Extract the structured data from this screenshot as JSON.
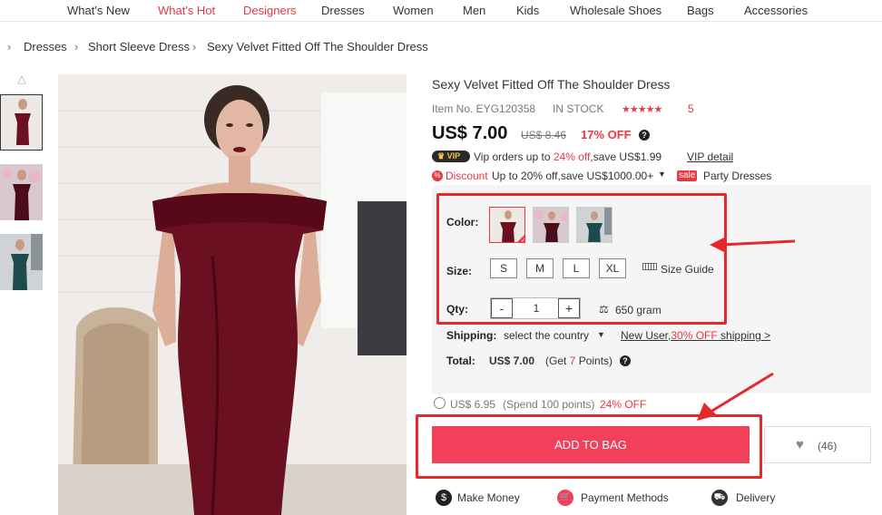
{
  "nav": [
    "What's New",
    "What's Hot",
    "Designers",
    "Dresses",
    "Women",
    "Men",
    "Kids",
    "Wholesale Shoes",
    "Bags",
    "Accessories"
  ],
  "breadcrumb": [
    "Dresses",
    "Short Sleeve Dress",
    "Sexy Velvet Fitted Off The Shoulder Dress"
  ],
  "product": {
    "title": "Sexy Velvet Fitted Off The Shoulder Dress",
    "item_no": "Item No. EYG120358",
    "stock": "IN STOCK",
    "review_count": "5",
    "rating": 5,
    "price": "US$ 7.00",
    "old_price": "US$ 8.46",
    "off": "17% OFF"
  },
  "vip": {
    "badge": "VIP",
    "text_before": "Vip orders up to",
    "percent": "24% off",
    "text_after": ",save US$1.99",
    "detail_link": "VIP detail"
  },
  "discount": {
    "label": "Discount",
    "text": "Up to 20% off,save US$1000.00+",
    "sale_tag": "sale",
    "category": "Party Dresses"
  },
  "options": {
    "color_label": "Color:",
    "size_label": "Size:",
    "sizes": [
      "S",
      "M",
      "L",
      "XL"
    ],
    "size_guide": "Size Guide",
    "qty_label": "Qty:",
    "qty_minus": "-",
    "qty_value": "1",
    "qty_plus": "+",
    "weight": "650 gram",
    "shipping_label": "Shipping:",
    "shipping_value": "select the country",
    "new_user_text": "New User,",
    "new_user_pct": "30% OFF",
    "new_user_after": " shipping >",
    "total_label": "Total:",
    "total_value": "US$ 7.00",
    "points_before": "(Get ",
    "points_num": "7",
    "points_after": " Points)"
  },
  "points_offer": {
    "price": "US$ 6.95",
    "spend": "(Spend 100 points)",
    "off": "24% OFF"
  },
  "actions": {
    "add_to_bag": "ADD TO BAG",
    "wishlist_count": "(46)"
  },
  "features": [
    "Make Money",
    "Payment Methods",
    "Delivery"
  ],
  "colors": {
    "accent": "#e53945",
    "button": "#f2405a",
    "callout": "#e8272c",
    "dress": "#6b1020"
  }
}
